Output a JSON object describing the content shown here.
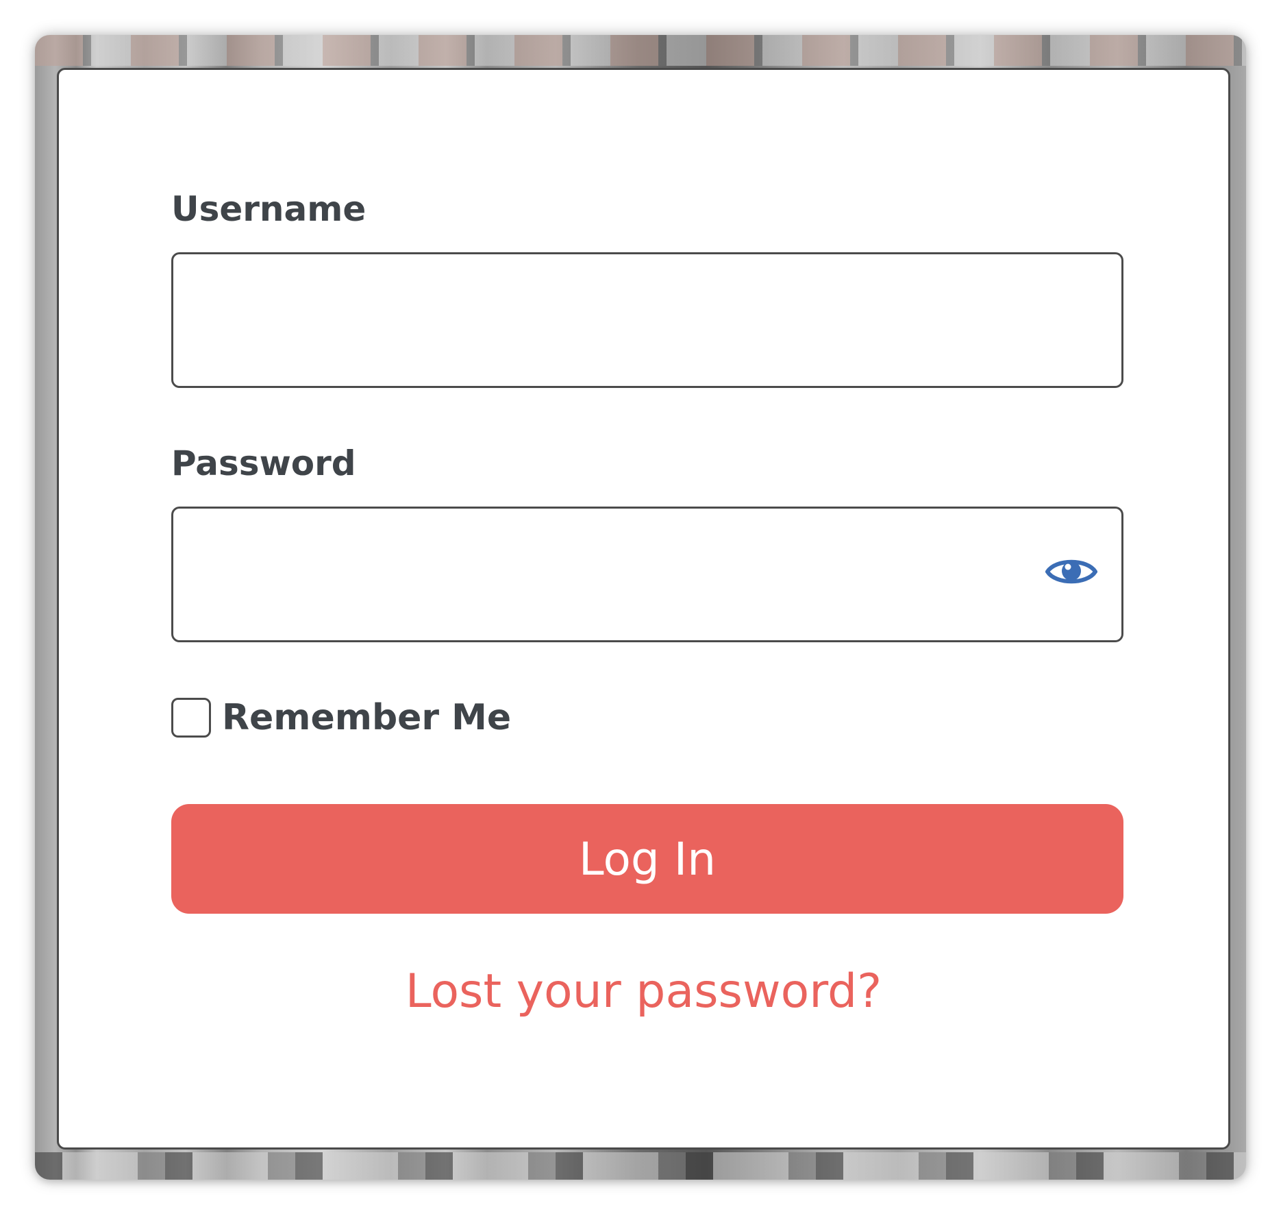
{
  "login_form": {
    "username": {
      "label": "Username",
      "value": "",
      "placeholder": ""
    },
    "password": {
      "label": "Password",
      "value": "",
      "placeholder": "",
      "toggle_icon": "eye-icon"
    },
    "remember_me": {
      "label": "Remember Me",
      "checked": false
    },
    "submit_label": "Log In",
    "lost_password_label": "Lost your password?"
  },
  "colors": {
    "accent": "#ea635d",
    "label_text": "#3f4449",
    "eye_icon": "#3b6db5"
  }
}
